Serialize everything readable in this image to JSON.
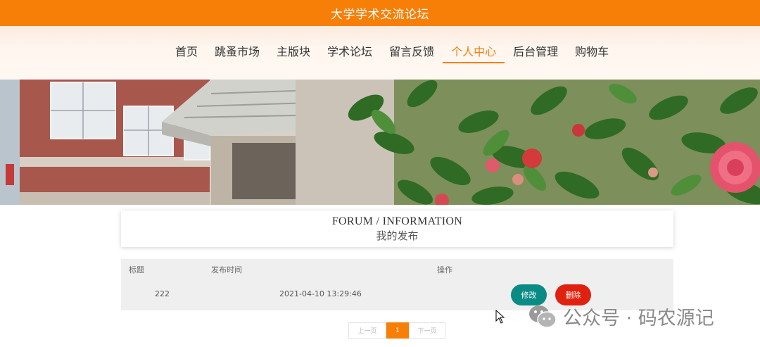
{
  "header": {
    "site_title": "大学学术交流论坛"
  },
  "nav": {
    "items": [
      {
        "label": "首页",
        "active": false
      },
      {
        "label": "跳蚤市场",
        "active": false
      },
      {
        "label": "主版块",
        "active": false
      },
      {
        "label": "学术论坛",
        "active": false
      },
      {
        "label": "留言反馈",
        "active": false
      },
      {
        "label": "个人中心",
        "active": true
      },
      {
        "label": "后台管理",
        "active": false
      },
      {
        "label": "购物车",
        "active": false
      }
    ]
  },
  "section": {
    "title_en": "FORUM / INFORMATION",
    "title_cn": "我的发布"
  },
  "table": {
    "headers": {
      "title": "标题",
      "time": "发布时间",
      "actions": "操作"
    },
    "rows": [
      {
        "title": "222",
        "time": "2021-04-10 13:29:46",
        "edit_label": "修改",
        "delete_label": "删除"
      }
    ]
  },
  "pagination": {
    "prev_label": "上一页",
    "current_page": "1",
    "next_label": "下一页"
  },
  "watermark": {
    "text": "公众号 · 码农源记"
  },
  "colors": {
    "brand": "#f77f07",
    "edit": "#0a8c85",
    "delete": "#e0210f"
  }
}
